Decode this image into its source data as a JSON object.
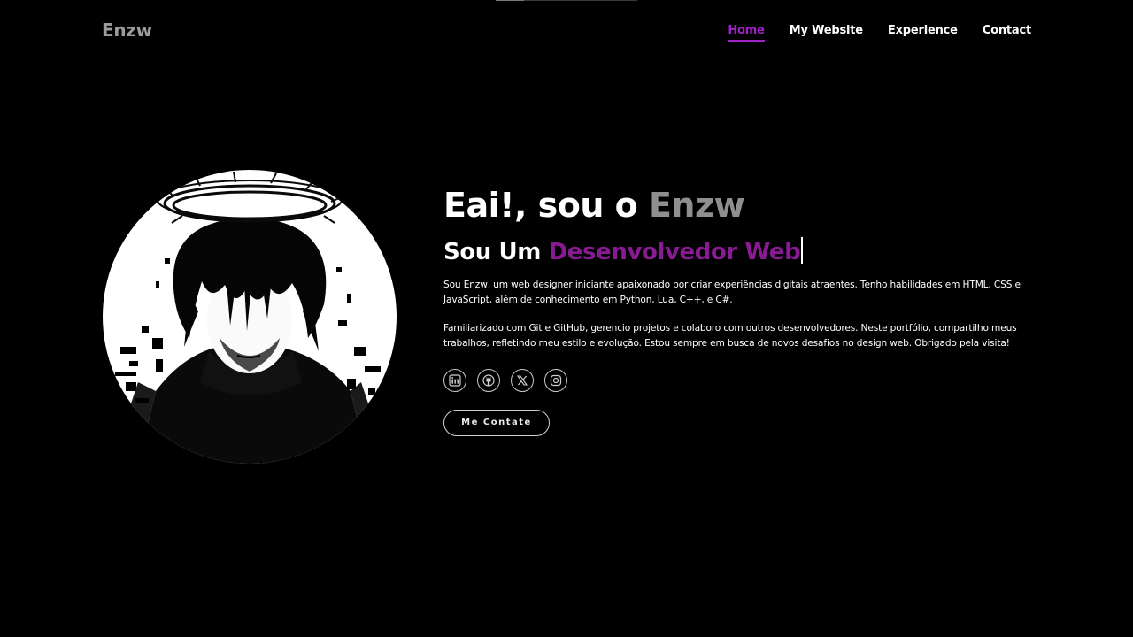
{
  "header": {
    "logo": "Enzw",
    "nav": [
      "Home",
      "My Website",
      "Experience",
      "Contact"
    ],
    "active_nav": "Home"
  },
  "hero": {
    "greeting_prefix": "Eai!, sou o ",
    "greeting_name": "Enzw",
    "role_prefix": "Sou Um ",
    "role_highlight": "Desenvolvedor Web",
    "paragraph_1": "Sou Enzw, um web designer iniciante apaixonado por criar experiências digitais atraentes. Tenho habilidades em HTML, CSS e JavaScript, além de conhecimento em Python, Lua, C++, e C#.",
    "paragraph_2": "Familiarizado com Git e GitHub, gerencio projetos e colaboro com outros desenvolvedores. Neste portfólio, compartilho meus trabalhos, refletindo meu estilo e evolução. Estou sempre em busca de novos desafios no design web. Obrigado pela visita!",
    "socials": [
      "linkedin-icon",
      "github-icon",
      "x-twitter-icon",
      "instagram-icon"
    ],
    "cta_label": "Me Contate"
  },
  "colors": {
    "accent": "#a020c8",
    "role_highlight": "#8a1a94",
    "name_gray": "#8f8f8f",
    "background": "#000000"
  }
}
